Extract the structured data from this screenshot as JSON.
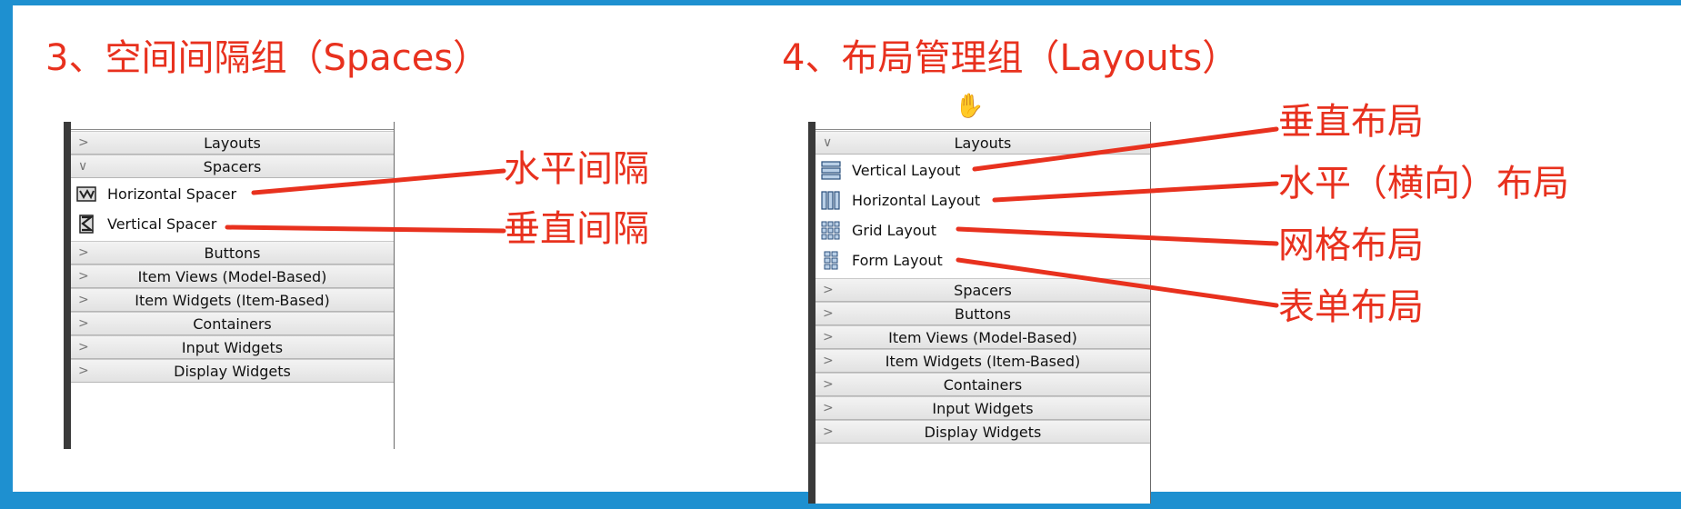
{
  "left": {
    "heading": "3、空间间隔组（Spaces）",
    "categories_top": [
      "Layouts",
      "Spacers"
    ],
    "items": [
      {
        "label": "Horizontal Spacer",
        "icon": "horizontal-spacer-icon"
      },
      {
        "label": "Vertical Spacer",
        "icon": "vertical-spacer-icon"
      }
    ],
    "categories_bottom": [
      "Buttons",
      "Item Views (Model-Based)",
      "Item Widgets (Item-Based)",
      "Containers",
      "Input Widgets",
      "Display Widgets"
    ],
    "annotations": [
      "水平间隔",
      "垂直间隔"
    ]
  },
  "right": {
    "heading": "4、布局管理组（Layouts）",
    "categories_top": [
      "Layouts"
    ],
    "items": [
      {
        "label": "Vertical Layout",
        "icon": "vertical-layout-icon"
      },
      {
        "label": "Horizontal Layout",
        "icon": "horizontal-layout-icon"
      },
      {
        "label": "Grid Layout",
        "icon": "grid-layout-icon"
      },
      {
        "label": "Form Layout",
        "icon": "form-layout-icon"
      }
    ],
    "categories_bottom": [
      "Spacers",
      "Buttons",
      "Item Views (Model-Based)",
      "Item Widgets (Item-Based)",
      "Containers",
      "Input Widgets",
      "Display Widgets"
    ],
    "annotations": [
      "垂直布局",
      "水平（横向）布局",
      "网格布局",
      "表单布局"
    ]
  },
  "colors": {
    "accent_red": "#e8311e",
    "frame_blue": "#1e90d0"
  }
}
